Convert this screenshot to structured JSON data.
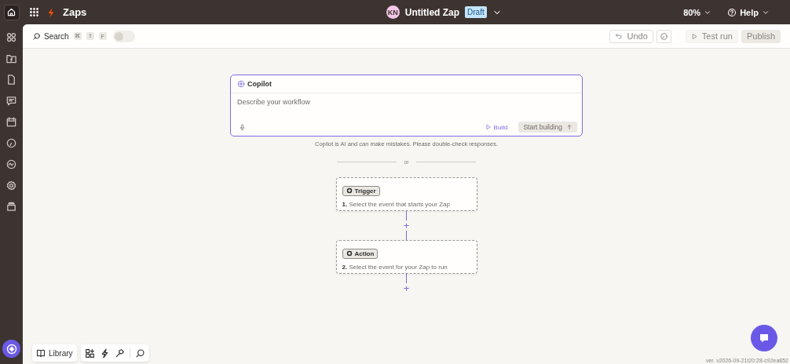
{
  "topbar": {
    "app_name": "Zaps",
    "avatar_initials": "KN",
    "zap_title": "Untitled Zap",
    "status_badge": "Draft",
    "zoom": "80%",
    "help": "Help"
  },
  "toolbar": {
    "search_label": "Search",
    "shortcut_keys": [
      "⌘",
      "⇧",
      "F"
    ],
    "toggle_on": false,
    "undo": "Undo",
    "test_run": "Test run",
    "publish": "Publish"
  },
  "copilot": {
    "title": "Copilot",
    "placeholder": "Describe your workflow",
    "build": "Build",
    "start": "Start building",
    "disclaimer": "Copilot is AI and can make mistakes. Please double-check responses."
  },
  "divider_label": "or",
  "steps": [
    {
      "badge": "Trigger",
      "number": "1.",
      "text": "Select the event that starts your Zap"
    },
    {
      "badge": "Action",
      "number": "2.",
      "text": "Select the event for your Zap to run"
    }
  ],
  "plus_label": "+",
  "bottom_toolbar": {
    "library": "Library"
  },
  "version": "ver. v2026-09-21t20:28-c92ea852"
}
